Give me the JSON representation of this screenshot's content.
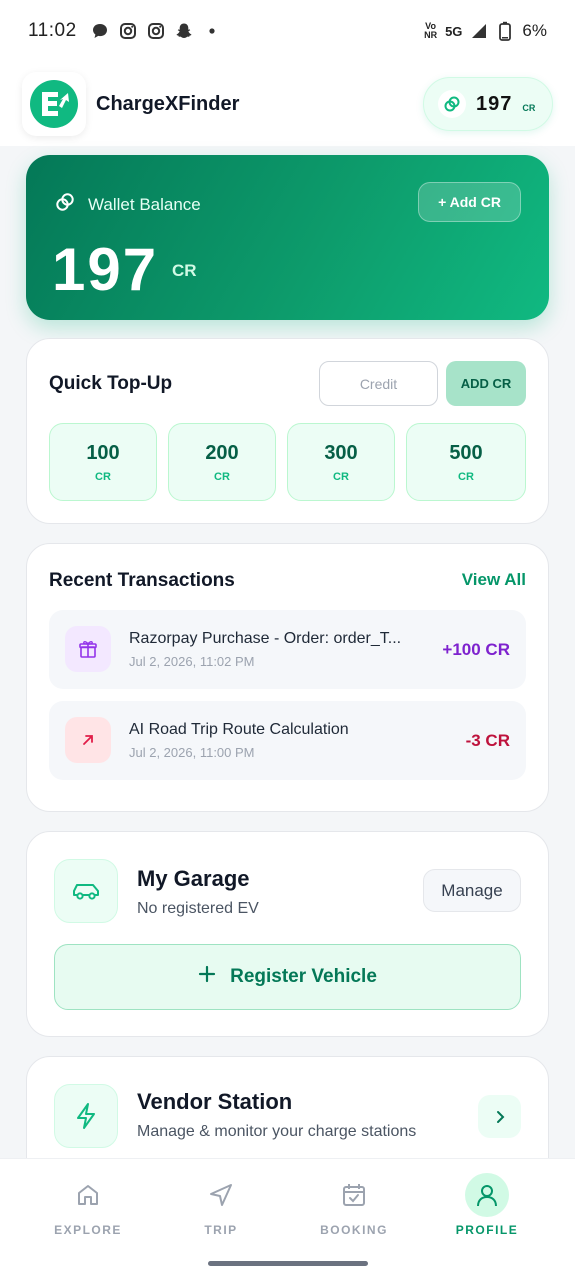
{
  "status_bar": {
    "time": "11:02",
    "network": "5G",
    "volte": "Vo¹⁸ NR",
    "battery": "6%"
  },
  "header": {
    "app_name": "ChargeXFinder",
    "credits_value": "197",
    "credits_unit": "CR"
  },
  "wallet": {
    "label": "Wallet Balance",
    "add_button": "+ Add CR",
    "amount": "197",
    "unit": "CR"
  },
  "quick_topup": {
    "title": "Quick Top-Up",
    "input_placeholder": "Credit",
    "add_button": "ADD CR",
    "options": [
      {
        "value": "100",
        "unit": "CR"
      },
      {
        "value": "200",
        "unit": "CR"
      },
      {
        "value": "300",
        "unit": "CR"
      },
      {
        "value": "500",
        "unit": "CR"
      }
    ]
  },
  "transactions": {
    "title": "Recent Transactions",
    "view_all": "View All",
    "items": [
      {
        "title": "Razorpay Purchase - Order: order_T...",
        "date": "Jul 2, 2026, 11:02 PM",
        "amount": "+100 CR",
        "icon": "gift-icon",
        "color": "#7e22ce"
      },
      {
        "title": "AI Road Trip Route Calculation",
        "date": "Jul 2, 2026, 11:00 PM",
        "amount": "-3 CR",
        "icon": "arrow-up-right-icon",
        "color": "#be123c"
      }
    ]
  },
  "garage": {
    "title": "My Garage",
    "subtitle": "No registered EV",
    "manage_button": "Manage",
    "register_button": "Register Vehicle"
  },
  "vendor": {
    "title": "Vendor Station",
    "subtitle": "Manage & monitor your charge stations"
  },
  "bottom_nav": {
    "items": [
      {
        "label": "EXPLORE",
        "icon": "home-icon",
        "active": false
      },
      {
        "label": "TRIP",
        "icon": "navigation-icon",
        "active": false
      },
      {
        "label": "BOOKING",
        "icon": "calendar-check-icon",
        "active": false
      },
      {
        "label": "PROFILE",
        "icon": "user-icon",
        "active": true
      }
    ]
  },
  "colors": {
    "accent": "#10b981",
    "accent_dark": "#047857",
    "credit_positive": "#7e22ce",
    "credit_negative": "#be123c"
  }
}
